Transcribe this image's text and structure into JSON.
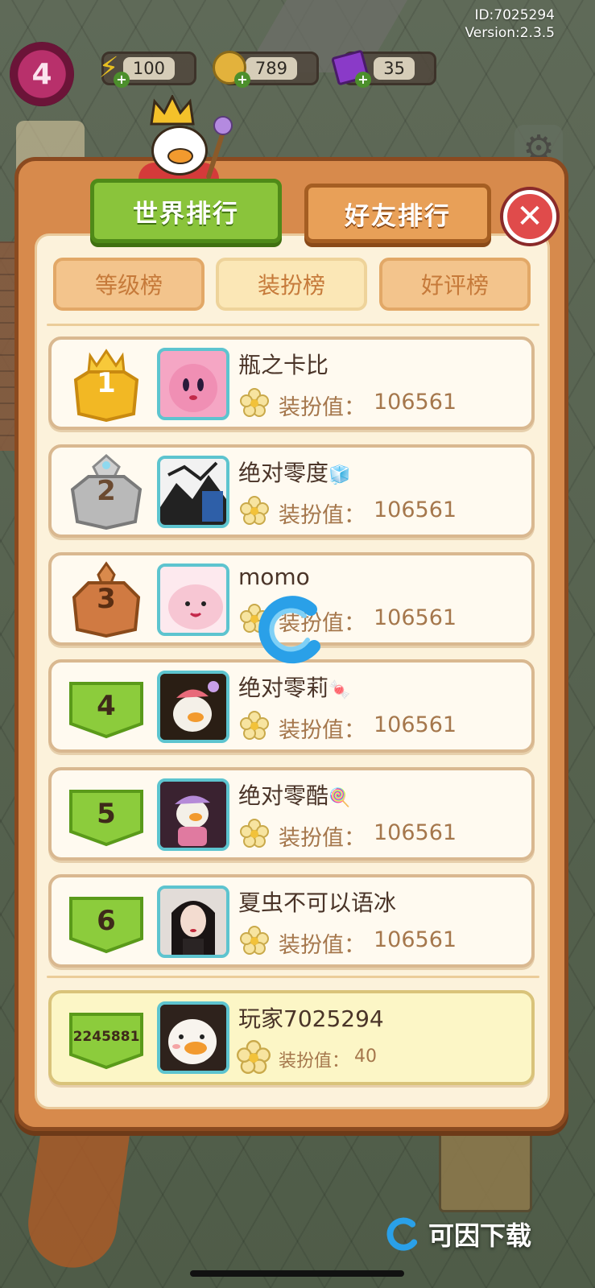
{
  "hud": {
    "id_text": "ID:7025294",
    "version_text": "Version:2.3.5",
    "level": "4",
    "energy": "100",
    "coins": "789",
    "gems": "35"
  },
  "tabs": {
    "world": "世界排行",
    "friends": "好友排行"
  },
  "subtabs": [
    "等级榜",
    "装扮榜",
    "好评榜"
  ],
  "selected_subtab": "装扮榜",
  "score_label": "装扮值：",
  "leaderboard": [
    {
      "rank": "1",
      "name": "瓶之卡比",
      "badge": "",
      "score": "106561"
    },
    {
      "rank": "2",
      "name": "绝对零度",
      "badge": "🧊",
      "score": "106561"
    },
    {
      "rank": "3",
      "name": "momo",
      "badge": "",
      "score": "106561"
    },
    {
      "rank": "4",
      "name": "绝对零莉",
      "badge": "🍬",
      "score": "106561"
    },
    {
      "rank": "5",
      "name": "绝对零酷",
      "badge": "🍭",
      "score": "106561"
    },
    {
      "rank": "6",
      "name": "夏虫不可以语冰",
      "badge": "",
      "score": "106561"
    }
  ],
  "me": {
    "rank": "2245881",
    "name": "玩家7025294",
    "score": "40"
  },
  "watermark": "可因下载",
  "colors": {
    "panel": "#d78a4c",
    "tab_active": "#8ac43b",
    "tab_inactive": "#e8a058",
    "gold": "#f2b824",
    "silver": "#b9b9b9",
    "bronze": "#d07a42",
    "green_rank": "#8ccc3c"
  }
}
